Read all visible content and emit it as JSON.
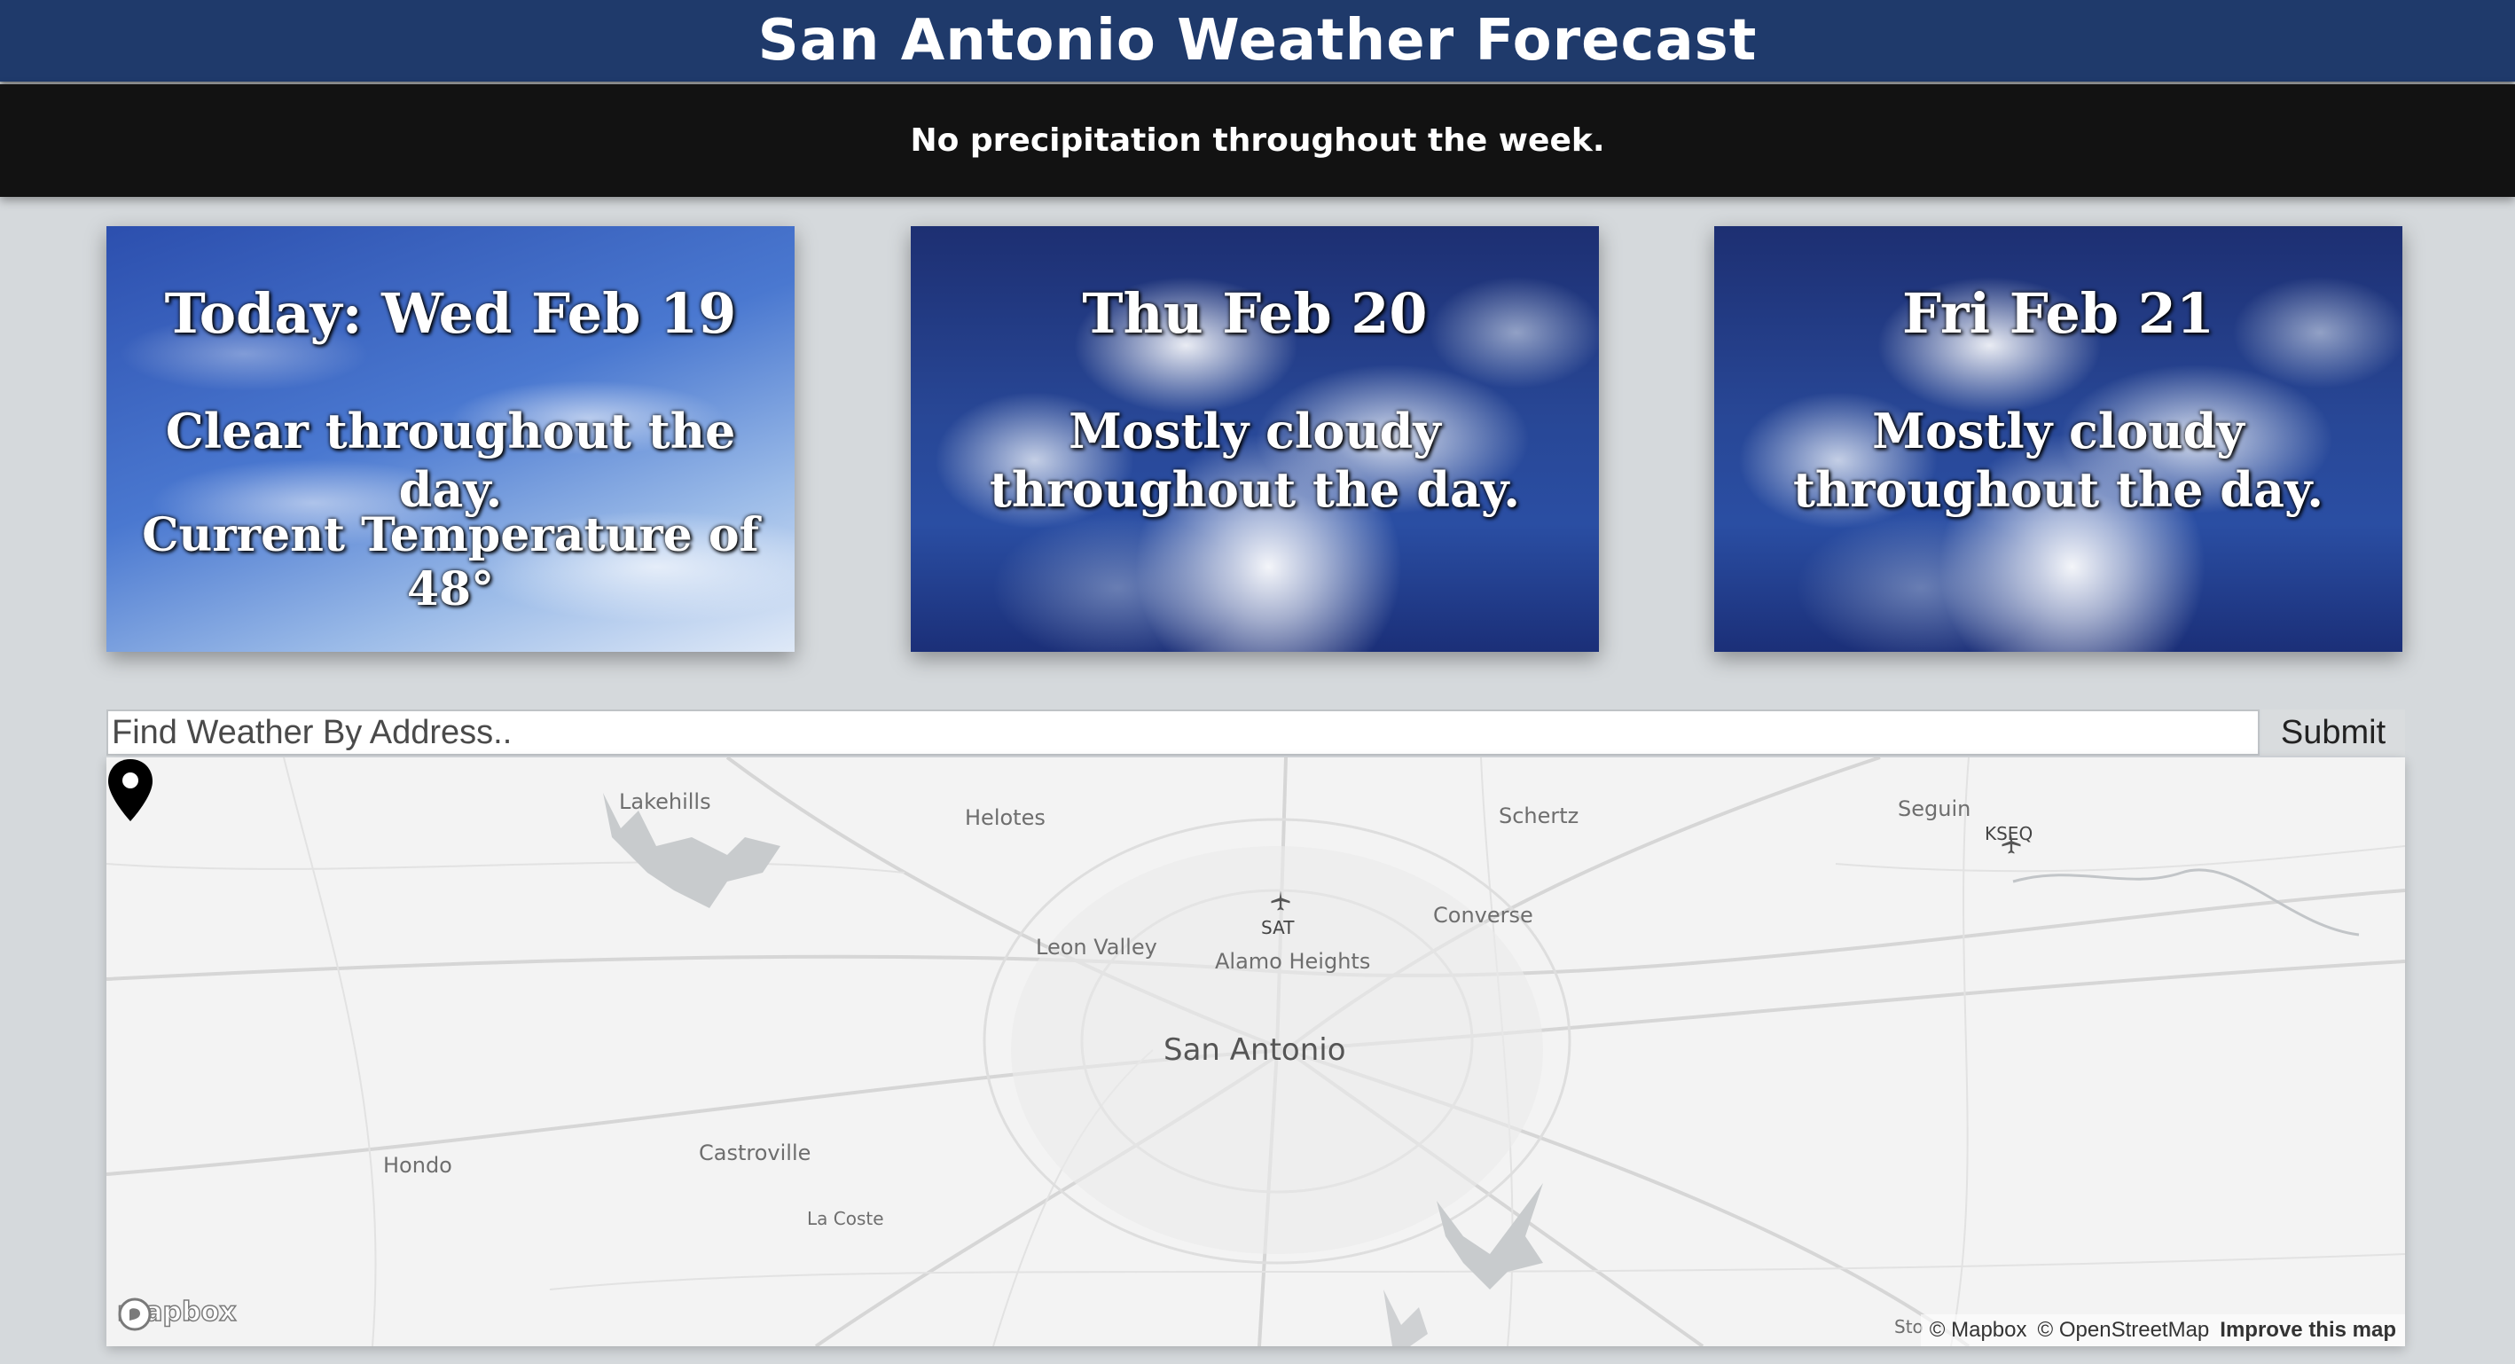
{
  "header": {
    "title": "San Antonio Weather Forecast"
  },
  "summary": {
    "text": "No precipitation throughout the week."
  },
  "forecast": [
    {
      "title": "Today: Wed Feb 19",
      "description": "Clear throughout the day.",
      "temperature": "Current Temperature of 48°"
    },
    {
      "title": "Thu Feb 20",
      "description": "Mostly cloudy throughout the day."
    },
    {
      "title": "Fri Feb 21",
      "description": "Mostly cloudy throughout the day."
    }
  ],
  "search": {
    "placeholder": "Find Weather By Address..",
    "value": "",
    "submit_label": "Submit"
  },
  "map": {
    "labels": {
      "lakehills": "Lakehills",
      "helotes": "Helotes",
      "schertz": "Schertz",
      "seguin": "Seguin",
      "kseq": "KSEQ",
      "sat": "SAT",
      "converse": "Converse",
      "leon_valley": "Leon Valley",
      "alamo_heights": "Alamo Heights",
      "san_antonio": "San Antonio",
      "hondo": "Hondo",
      "castroville": "Castroville",
      "la_coste": "La Coste",
      "sto": "Sto"
    },
    "logo": "mapbox",
    "attribution": {
      "mapbox": "© Mapbox",
      "osm": "© OpenStreetMap",
      "improve": "Improve this map"
    }
  }
}
